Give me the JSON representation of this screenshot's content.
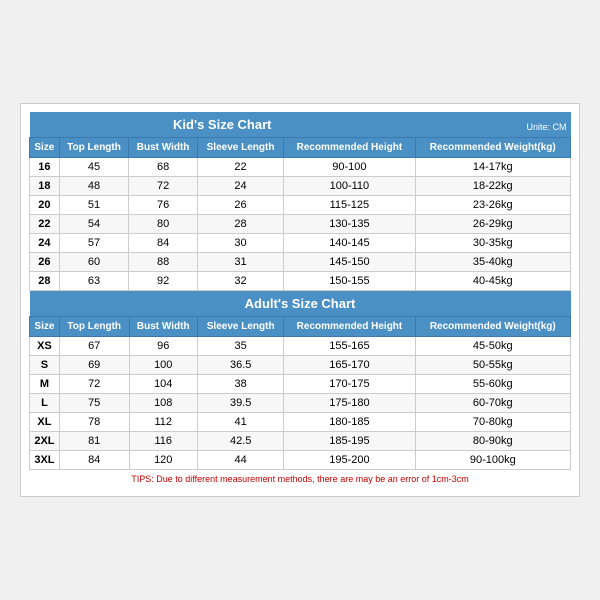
{
  "kids_chart": {
    "title": "Kid's Size Chart",
    "unit": "Unite: CM",
    "headers": [
      "Size",
      "Top Length",
      "Bust Width",
      "Sleeve Length",
      "Recommended Height",
      "Recommended Weight(kg)"
    ],
    "rows": [
      [
        "16",
        "45",
        "68",
        "22",
        "90-100",
        "14-17kg"
      ],
      [
        "18",
        "48",
        "72",
        "24",
        "100-110",
        "18-22kg"
      ],
      [
        "20",
        "51",
        "76",
        "26",
        "115-125",
        "23-26kg"
      ],
      [
        "22",
        "54",
        "80",
        "28",
        "130-135",
        "26-29kg"
      ],
      [
        "24",
        "57",
        "84",
        "30",
        "140-145",
        "30-35kg"
      ],
      [
        "26",
        "60",
        "88",
        "31",
        "145-150",
        "35-40kg"
      ],
      [
        "28",
        "63",
        "92",
        "32",
        "150-155",
        "40-45kg"
      ]
    ]
  },
  "adults_chart": {
    "title": "Adult's Size Chart",
    "headers": [
      "Size",
      "Top Length",
      "Bust Width",
      "Sleeve Length",
      "Recommended Height",
      "Recommended Weight(kg)"
    ],
    "rows": [
      [
        "XS",
        "67",
        "96",
        "35",
        "155-165",
        "45-50kg"
      ],
      [
        "S",
        "69",
        "100",
        "36.5",
        "165-170",
        "50-55kg"
      ],
      [
        "M",
        "72",
        "104",
        "38",
        "170-175",
        "55-60kg"
      ],
      [
        "L",
        "75",
        "108",
        "39.5",
        "175-180",
        "60-70kg"
      ],
      [
        "XL",
        "78",
        "112",
        "41",
        "180-185",
        "70-80kg"
      ],
      [
        "2XL",
        "81",
        "116",
        "42.5",
        "185-195",
        "80-90kg"
      ],
      [
        "3XL",
        "84",
        "120",
        "44",
        "195-200",
        "90-100kg"
      ]
    ],
    "tips": "TIPS: Due to different measurement methods, there are may be an error of 1cm-3cm"
  }
}
